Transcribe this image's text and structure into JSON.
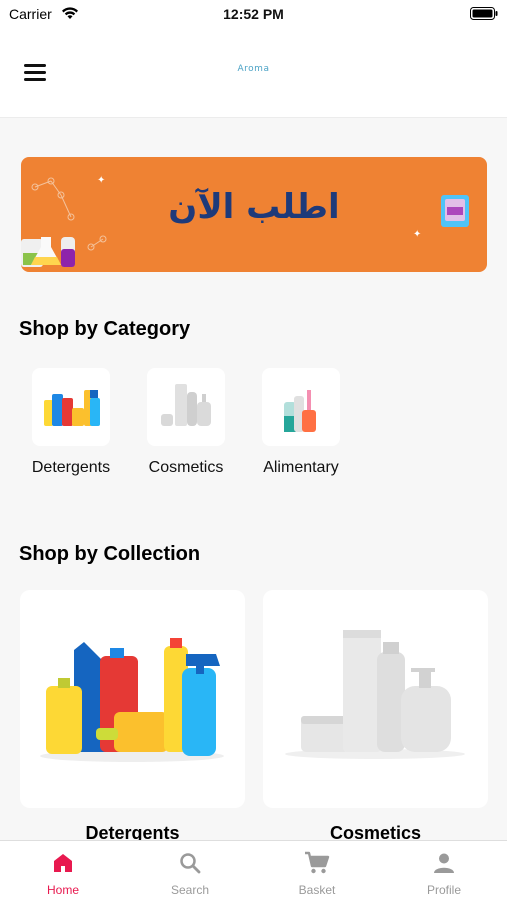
{
  "status_bar": {
    "carrier": "Carrier",
    "time": "12:52 PM"
  },
  "header": {
    "logo_text": "Aroma"
  },
  "banner": {
    "text": "اطلب الآن"
  },
  "categories_section": {
    "title": "Shop by Category",
    "items": [
      {
        "label": "Detergents",
        "icon": "detergents-icon"
      },
      {
        "label": "Cosmetics",
        "icon": "cosmetics-icon"
      },
      {
        "label": "Alimentary",
        "icon": "alimentary-icon"
      }
    ]
  },
  "collections_section": {
    "title": "Shop by Collection",
    "items": [
      {
        "label": "Detergents",
        "icon": "detergents-photo"
      },
      {
        "label": "Cosmetics",
        "icon": "cosmetics-photo"
      }
    ]
  },
  "tabbar": {
    "active_color": "#e8194f",
    "inactive_color": "#9a9a9a",
    "tabs": [
      {
        "label": "Home",
        "icon": "home-icon",
        "active": true
      },
      {
        "label": "Search",
        "icon": "search-icon",
        "active": false
      },
      {
        "label": "Basket",
        "icon": "cart-icon",
        "active": false
      },
      {
        "label": "Profile",
        "icon": "profile-icon",
        "active": false
      }
    ]
  },
  "colors": {
    "banner": "#ef8233",
    "banner_text": "#1e3a7a",
    "background": "#f7f7f7"
  }
}
